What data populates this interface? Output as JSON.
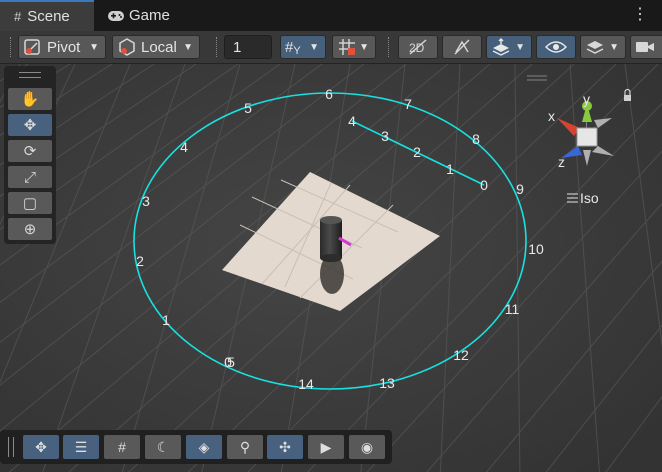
{
  "tabs": [
    {
      "label": "Scene",
      "icon": "grid-icon",
      "active": true
    },
    {
      "label": "Game",
      "icon": "gamepad-icon",
      "active": false
    }
  ],
  "toolbar": {
    "pivot_label": "Pivot",
    "local_label": "Local",
    "grid_snap_value": "1",
    "grid_axis_label": "Y"
  },
  "overlay": {
    "iso_label": "Iso",
    "gizmo_x": "x",
    "gizmo_y": "y",
    "gizmo_z": "z"
  },
  "tools": [
    "hand-tool",
    "move-tool",
    "rotate-tool",
    "scale-tool",
    "rect-tool",
    "transform-tool"
  ],
  "bottom_tools": [
    "move",
    "align",
    "grid",
    "moon",
    "surface",
    "magnify",
    "nodes",
    "camera",
    "compass"
  ],
  "circle_labels": [
    "0",
    "1",
    "2",
    "3",
    "4",
    "5",
    "6",
    "7",
    "8",
    "9",
    "10",
    "11",
    "12",
    "13",
    "14",
    "5"
  ],
  "line_labels": [
    "0",
    "1",
    "2",
    "3",
    "4"
  ],
  "colors": {
    "accent": "#46607c",
    "cyan": "#19e0e0",
    "plane": "#e3d9cf"
  }
}
